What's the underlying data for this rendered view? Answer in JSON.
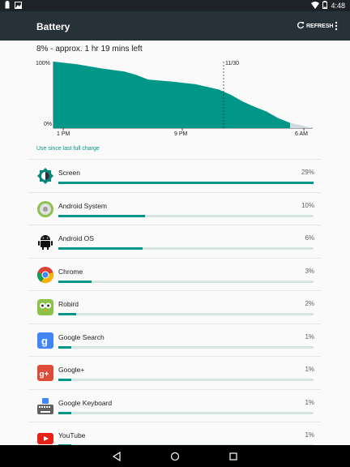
{
  "status_bar": {
    "time": "4:48"
  },
  "app_bar": {
    "title": "Battery",
    "refresh_label": "REFRESH"
  },
  "summary": "8% - approx. 1 hr 19 mins left",
  "chart_data": {
    "type": "area",
    "ylim": [
      0,
      100
    ],
    "y_tick_labels": [
      "100%",
      "0%"
    ],
    "x_tick_labels": [
      "1 PM",
      "9 PM",
      "6 AM"
    ],
    "marker_label": "11/30",
    "x": [
      0,
      0.1,
      0.2,
      0.3,
      0.35,
      0.4,
      0.5,
      0.6,
      0.7,
      0.75,
      0.8,
      0.85,
      0.9,
      0.95,
      1.0
    ],
    "values": [
      100,
      96,
      90,
      85,
      80,
      73,
      70,
      66,
      58,
      50,
      40,
      32,
      25,
      15,
      8
    ],
    "fill_color": "#009688",
    "projection_color": "#cfd8dc"
  },
  "section_label": "Use since last full charge",
  "apps": [
    {
      "name": "Screen",
      "percent": "29%",
      "fraction": 0.29,
      "icon": "brightness-icon"
    },
    {
      "name": "Android System",
      "percent": "10%",
      "fraction": 0.1,
      "icon": "android-system-icon"
    },
    {
      "name": "Android OS",
      "percent": "6%",
      "fraction": 0.06,
      "icon": "android-robot-icon"
    },
    {
      "name": "Chrome",
      "percent": "3%",
      "fraction": 0.03,
      "icon": "chrome-icon"
    },
    {
      "name": "Robird",
      "percent": "2%",
      "fraction": 0.02,
      "icon": "robird-icon"
    },
    {
      "name": "Google Search",
      "percent": "1%",
      "fraction": 0.01,
      "icon": "google-search-icon"
    },
    {
      "name": "Google+",
      "percent": "1%",
      "fraction": 0.01,
      "icon": "google-plus-icon"
    },
    {
      "name": "Google Keyboard",
      "percent": "1%",
      "fraction": 0.01,
      "icon": "keyboard-icon"
    },
    {
      "name": "YouTube",
      "percent": "1%",
      "fraction": 0.01,
      "icon": "youtube-icon"
    }
  ]
}
